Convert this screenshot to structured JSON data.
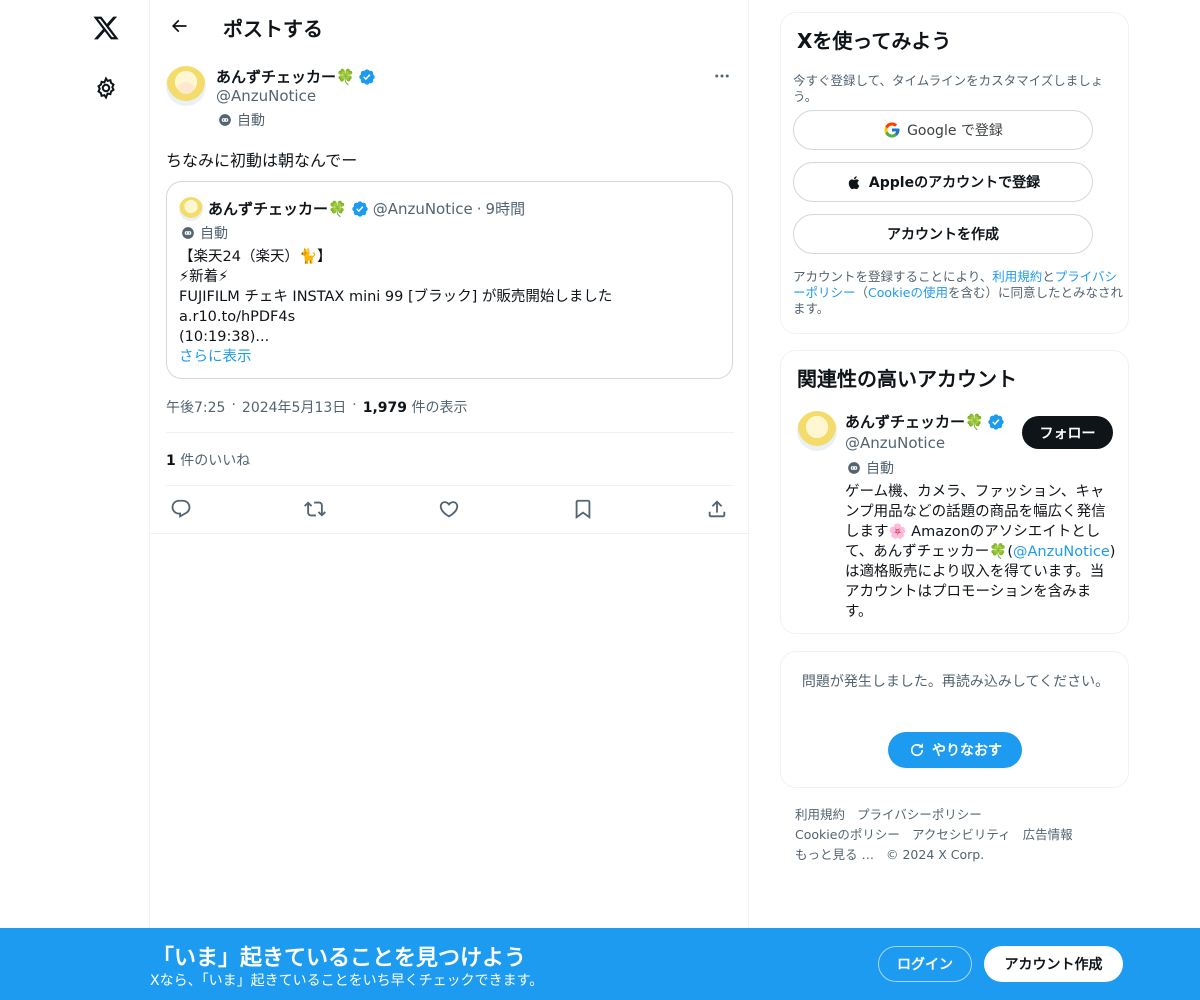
{
  "nav": {
    "logo_icon": "x-logo-icon",
    "settings_icon": "gear-icon"
  },
  "header": {
    "title": "ポストする"
  },
  "post": {
    "author_name": "あんずチェッカー🍀",
    "author_handle": "@AnzuNotice",
    "auto_label": "自動",
    "text": "ちなみに初動は朝なんでー",
    "quote": {
      "author_name": "あんずチェッカー🍀",
      "author_handle": "@AnzuNotice",
      "separator": "·",
      "time": "9時間",
      "auto_label": "自動",
      "lines": [
        "【楽天24（楽天）🐈】",
        "⚡新着⚡",
        "FUJIFILM チェキ INSTAX mini 99 [ブラック] が販売開始しました",
        "a.r10.to/hPDF4s",
        "(10:19:38)..."
      ],
      "show_more": "さらに表示"
    },
    "time": "午後7:25",
    "dot": "·",
    "date": "2024年5月13日",
    "views_count": "1,979",
    "views_label": "件の表示",
    "likes_count": "1",
    "likes_label": "件のいいね"
  },
  "signup": {
    "title": "Xを使ってみよう",
    "subtitle": "今すぐ登録して、タイムラインをカスタマイズしましょう。",
    "google_label": "Google で登録",
    "apple_label": "Appleのアカウントで登録",
    "create_label": "アカウントを作成",
    "legal_pre": "アカウントを登録することにより、",
    "legal_terms": "利用規約",
    "legal_and": "と",
    "legal_privacy": "プライバシーポリシー",
    "legal_paren_open": "（",
    "legal_cookie": "Cookieの使用",
    "legal_post": "を含む）に同意したとみなされます。"
  },
  "related": {
    "title": "関連性の高いアカウント",
    "name": "あんずチェッカー🍀",
    "handle": "@AnzuNotice",
    "auto_label": "自動",
    "follow_label": "フォロー",
    "bio_1": "ゲーム機、カメラ、ファッション、キャンプ用品などの話題の商品を幅広く発信します🌸 Amazonのアソシエイトとして、あんずチェッカー🍀(",
    "bio_mention": "@AnzuNotice",
    "bio_2": ")は適格販売により収入を得ています。当アカウントはプロモーションを含みます。"
  },
  "error": {
    "message": "問題が発生しました。再読み込みしてください。",
    "retry_label": "やりなおす"
  },
  "footer": {
    "links": [
      "利用規約",
      "プライバシーポリシー",
      "Cookieのポリシー",
      "アクセシビリティ",
      "広告情報",
      "もっと見る …",
      "© 2024 X Corp."
    ]
  },
  "banner": {
    "title": "「いま」起きていることを見つけよう",
    "subtitle": "Xなら、「いま」起きていることをいち早くチェックできます。",
    "login_label": "ログイン",
    "create_label": "アカウント作成"
  },
  "colors": {
    "accent": "#1d9bf0",
    "text": "#0f1419",
    "secondary": "#536471",
    "border": "#eff3f4"
  }
}
